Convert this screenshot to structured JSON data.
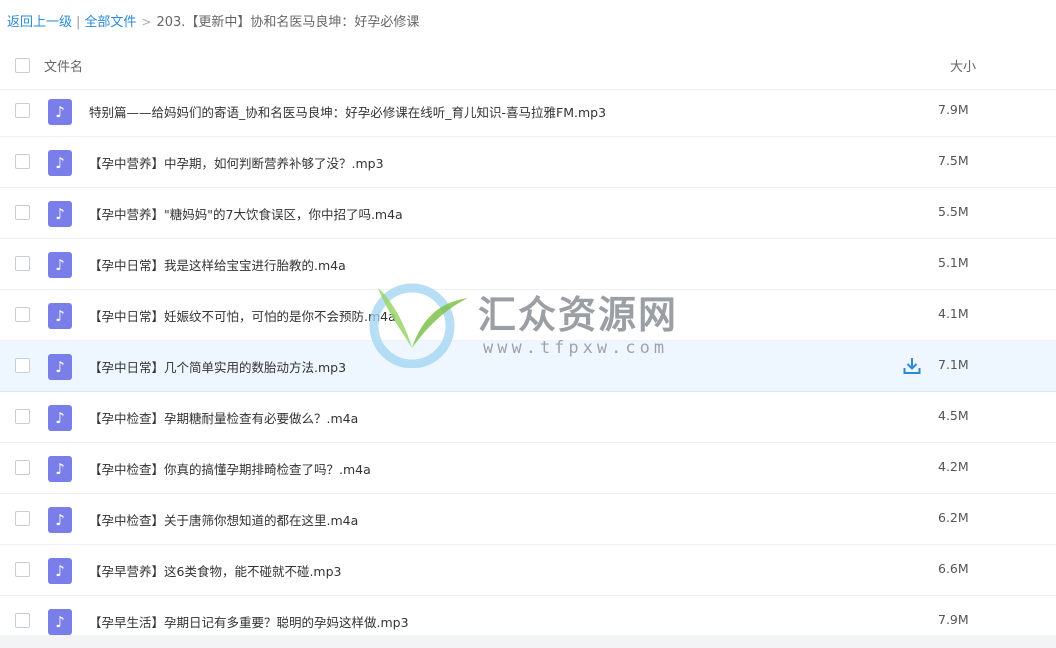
{
  "breadcrumb": {
    "back": "返回上一级",
    "all_files": "全部文件",
    "current": "203.【更新中】协和名医马良坤：好孕必修课"
  },
  "header": {
    "name_col": "文件名",
    "size_col": "大小"
  },
  "files": [
    {
      "name": "特别篇——给妈妈们的寄语_协和名医马良坤：好孕必修课在线听_育儿知识-喜马拉雅FM.mp3",
      "size": "7.9M"
    },
    {
      "name": "【孕中营养】中孕期，如何判断营养补够了没？.mp3",
      "size": "7.5M"
    },
    {
      "name": "【孕中营养】\"糖妈妈\"的7大饮食误区，你中招了吗.m4a",
      "size": "5.5M"
    },
    {
      "name": "【孕中日常】我是这样给宝宝进行胎教的.m4a",
      "size": "5.1M"
    },
    {
      "name": "【孕中日常】妊娠纹不可怕，可怕的是你不会预防.m4a",
      "size": "4.1M"
    },
    {
      "name": "【孕中日常】几个简单实用的数胎动方法.mp3",
      "size": "7.1M"
    },
    {
      "name": "【孕中检查】孕期糖耐量检查有必要做么？.m4a",
      "size": "4.5M"
    },
    {
      "name": "【孕中检查】你真的搞懂孕期排畸检查了吗？.m4a",
      "size": "4.2M"
    },
    {
      "name": "【孕中检查】关于唐筛你想知道的都在这里.m4a",
      "size": "6.2M"
    },
    {
      "name": "【孕早营养】这6类食物，能不碰就不碰.mp3",
      "size": "6.6M"
    },
    {
      "name": "【孕早生活】孕期日记有多重要？聪明的孕妈这样做.mp3",
      "size": "7.9M"
    }
  ],
  "file_icon": "music-note-icon",
  "hovered_row_index": 5,
  "watermark": {
    "title": "汇众资源网",
    "url": "www.tfpxw.com"
  },
  "colors": {
    "accent": "#2a8ad8",
    "file_icon_bg": "#7a7ee8",
    "hover_row": "#eef7ff"
  }
}
